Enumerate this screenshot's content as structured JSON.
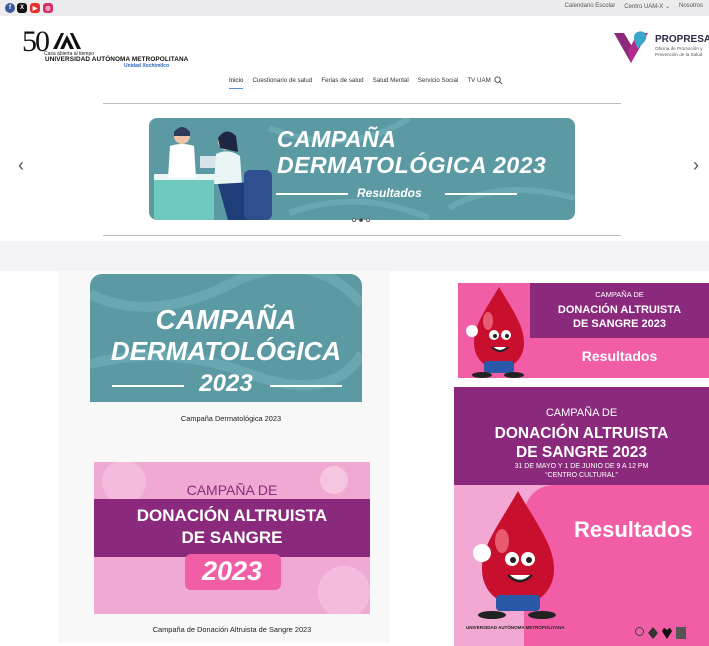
{
  "topbar": {
    "social": [
      "facebook-icon",
      "x-icon",
      "youtube-icon",
      "instagram-icon"
    ],
    "links": [
      "Calendario Escolar",
      "Centro UAM-X ⌄",
      "Nosotros"
    ]
  },
  "header": {
    "logo_number": "50",
    "logo_tagline": "Casa abierta al tiempo",
    "logo_name": "UNIVERSIDAD AUTÓNOMA METROPOLITANA",
    "logo_unit": "Unidad Xochimilco",
    "brand_name": "PROPRESA",
    "brand_sub": "Oficina de Promoción y Prevención de la Salud"
  },
  "nav": {
    "items": [
      "Inicio",
      "Cuestionario de salud",
      "Ferias de salud",
      "Salud Mental",
      "Servicio Social",
      "TV UAM"
    ]
  },
  "slider": {
    "title1": "CAMPAÑA",
    "title2": "DERMATOLÓGICA  2023",
    "subtitle": "Resultados",
    "prev": "‹",
    "next": "›",
    "dots": 3,
    "active_dot": 1
  },
  "cards": {
    "derm": {
      "line1": "CAMPAÑA",
      "line2": "DERMATOLÓGICA",
      "line3": "2023",
      "caption": "Campaña Dermatológica 2023"
    },
    "donation": {
      "line1": "CAMPAÑA DE",
      "line2": "DONACIÓN ALTRUISTA",
      "line3": "DE SANGRE",
      "year": "2023",
      "caption": "Campaña de Donación Altruista de Sangre 2023"
    },
    "donation_results_small": {
      "line1": "CAMPAÑA DE",
      "line2": "DONACIÓN ALTRUISTA",
      "line3": "DE SANGRE 2023",
      "result": "Resultados"
    },
    "donation_results_large": {
      "line1": "CAMPAÑA DE",
      "line2": "DONACIÓN ALTRUISTA",
      "line3": "DE SANGRE 2023",
      "line4": "31 DE MAYO Y 1 DE JUNIO DE 9 A 12 PM",
      "line5": "“CENTRO CULTURAL”",
      "result": "Resultados",
      "footer_org": "UNIVERSIDAD AUTÓNOMA METROPOLITANA"
    }
  },
  "colors": {
    "teal": "#5c9aa3",
    "purple": "#8b2a7c",
    "pink": "#f25ea6",
    "light_pink": "#f0a9d3"
  }
}
